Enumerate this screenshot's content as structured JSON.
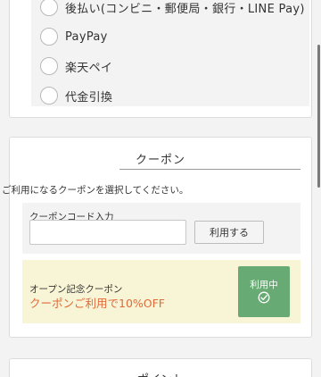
{
  "payment": {
    "options": [
      {
        "label": "後払い(コンビニ・郵便局・銀行・LINE Pay)"
      },
      {
        "label": "PayPay"
      },
      {
        "label": "楽天ペイ"
      },
      {
        "label": "代金引換"
      }
    ]
  },
  "coupon": {
    "title": "クーポン",
    "description": "ご利用になるクーポンを選択してください。",
    "code_label": "クーポンコード入力",
    "code_value": "",
    "apply_label": "利用する",
    "applied": {
      "name": "オープン記念クーポン",
      "offer": "クーポンご利用で10%OFF",
      "status_label": "利用中"
    }
  },
  "points": {
    "title": "ポイント"
  },
  "colors": {
    "accent_green": "#67aa73",
    "offer_orange": "#e06a3b",
    "coupon_bg": "#f8f5d6"
  }
}
